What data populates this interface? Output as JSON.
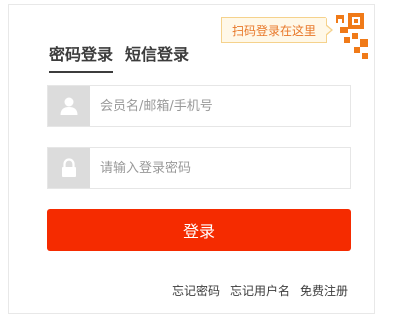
{
  "qr_tip": {
    "text": "扫码登录在这里"
  },
  "tabs": [
    {
      "label": "密码登录",
      "active": true
    },
    {
      "label": "短信登录",
      "active": false
    }
  ],
  "username": {
    "placeholder": "会员名/邮箱/手机号",
    "value": "",
    "icon": "user-icon"
  },
  "password": {
    "placeholder": "请输入登录密码",
    "value": "",
    "icon": "lock-icon"
  },
  "login_button": {
    "label": "登录"
  },
  "links": [
    {
      "label": "忘记密码"
    },
    {
      "label": "忘记用户名"
    },
    {
      "label": "免费注册"
    }
  ],
  "colors": {
    "accent": "#f52b00",
    "qr_orange": "#f07a18",
    "tip_text": "#e8782a",
    "tip_bg": "#fff8e8",
    "icon_bg": "#dcdcdc"
  }
}
